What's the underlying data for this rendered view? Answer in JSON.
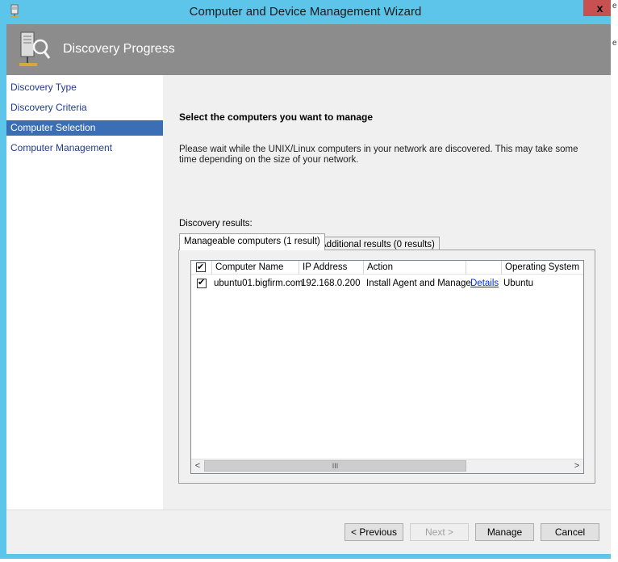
{
  "window": {
    "title": "Computer and Device Management Wizard",
    "close_glyph": "x",
    "icon": "server-icon"
  },
  "header": {
    "title": "Discovery Progress",
    "icon": "discovery-magnifier-icon"
  },
  "nav": {
    "items": [
      {
        "label": "Discovery Type",
        "selected": false
      },
      {
        "label": "Discovery Criteria",
        "selected": false
      },
      {
        "label": "Computer Selection",
        "selected": true
      },
      {
        "label": "Computer Management",
        "selected": false
      }
    ]
  },
  "content": {
    "heading": "Select the computers you want to manage",
    "description": "Please wait while the UNIX/Linux computers in your network are discovered. This may take some time depending on the size of your network.",
    "results_label": "Discovery results:",
    "tabs": [
      {
        "label": "Manageable computers (1 result)",
        "active": true
      },
      {
        "label": "Additional results (0 results)",
        "active": false
      }
    ],
    "table": {
      "select_all_checked": true,
      "columns": [
        "Computer Name",
        "IP Address",
        "Action",
        "",
        "Operating System"
      ],
      "rows": [
        {
          "checked": true,
          "computer_name": "ubuntu01.bigfirm.com",
          "ip_address": "192.168.0.200",
          "action": "Install Agent and Manage",
          "details_link": "Details",
          "operating_system": "Ubuntu"
        }
      ]
    },
    "scrollbar": {
      "left_arrow": "<",
      "right_arrow": ">",
      "thumb_grip": "III"
    }
  },
  "buttons": {
    "previous": "< Previous",
    "next": "Next >",
    "manage": "Manage",
    "cancel": "Cancel"
  },
  "edge_text": [
    "e",
    "e"
  ],
  "colors": {
    "frame": "#5dc4ea",
    "header": "#8c8c8c",
    "nav_selected": "#3a6fb5",
    "link": "#0033cc",
    "close": "#c75050"
  }
}
